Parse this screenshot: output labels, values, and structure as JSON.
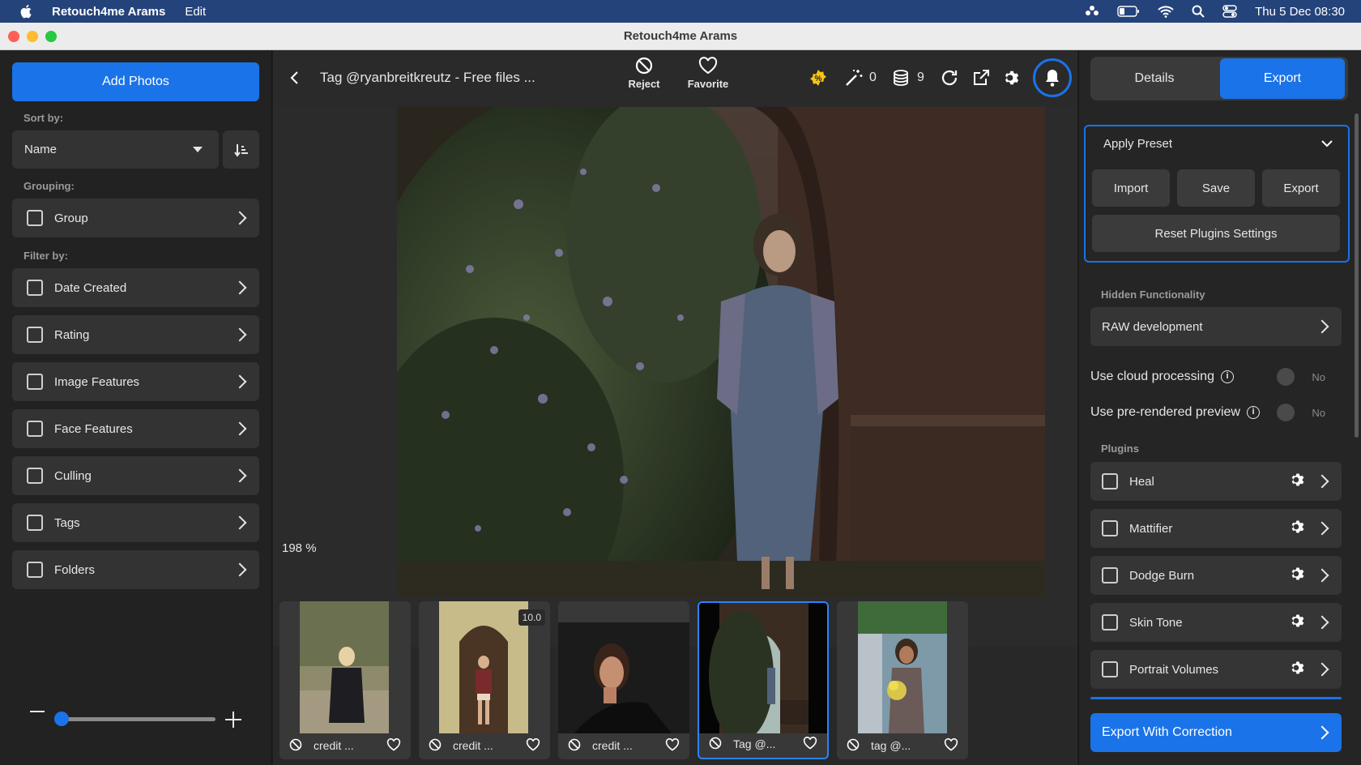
{
  "menubar": {
    "app_name": "Retouch4me Arams",
    "menu_edit": "Edit",
    "datetime": "Thu 5 Dec  08:30"
  },
  "window": {
    "title": "Retouch4me Arams"
  },
  "sidebar": {
    "add_photos": "Add Photos",
    "sort_by_label": "Sort by:",
    "sort_value": "Name",
    "grouping_label": "Grouping:",
    "group_label": "Group",
    "filter_by_label": "Filter by:",
    "filters": [
      "Date Created",
      "Rating",
      "Image Features",
      "Face Features",
      "Culling",
      "Tags",
      "Folders"
    ],
    "zoom_slider_value": 0.0
  },
  "toolbar": {
    "file_title": "Tag @ryanbreitkreutz - Free files ...",
    "reject_label": "Reject",
    "favorite_label": "Favorite",
    "magic_count": "0",
    "stack_count": "9"
  },
  "viewer": {
    "zoom_text": "198 %"
  },
  "filmstrip": [
    {
      "name": "credit ...",
      "badge": ""
    },
    {
      "name": "credit ...",
      "badge": "10.0"
    },
    {
      "name": "credit ...",
      "badge": ""
    },
    {
      "name": "Tag @...",
      "badge": ""
    },
    {
      "name": "tag @...",
      "badge": ""
    }
  ],
  "rightpanel": {
    "tab_details": "Details",
    "tab_export": "Export",
    "apply_preset": "Apply Preset",
    "import": "Import",
    "save": "Save",
    "export": "Export",
    "reset_plugins": "Reset Plugins Settings",
    "hidden_functionality": "Hidden Functionality",
    "raw_development": "RAW development",
    "cloud_processing": "Use cloud processing",
    "cloud_value": "No",
    "prerendered": "Use pre-rendered preview",
    "prerendered_value": "No",
    "plugins_label": "Plugins",
    "plugins": [
      "Heal",
      "Mattifier",
      "Dodge Burn",
      "Skin Tone",
      "Portrait Volumes"
    ],
    "export_with_correction": "Export With Correction"
  },
  "colors": {
    "accent": "#1a73e8",
    "selected_border": "#2a84ff"
  }
}
